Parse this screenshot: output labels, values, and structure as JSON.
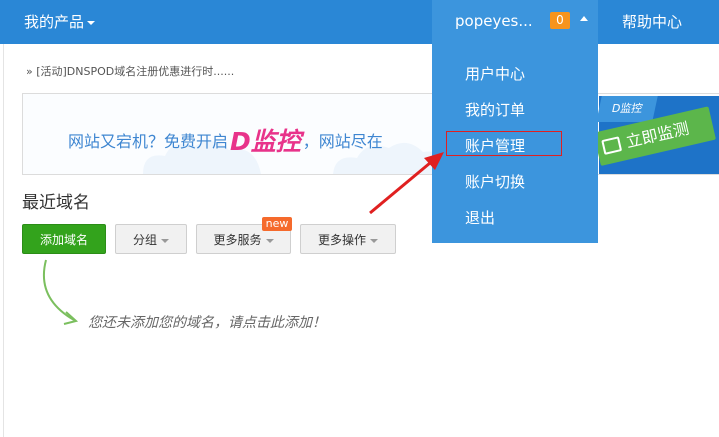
{
  "header": {
    "my_products": "我的产品",
    "username": "popeyes...",
    "message_count": "0",
    "help_center": "帮助中心"
  },
  "user_menu": {
    "items": [
      {
        "label": "用户中心"
      },
      {
        "label": "我的订单"
      },
      {
        "label": "账户管理"
      },
      {
        "label": "账户切换"
      },
      {
        "label": "退出"
      }
    ]
  },
  "announcement": "» [活动]DNSPOD域名注册优惠进行时......",
  "banner": {
    "text_before": "网站又宕机？免费开启",
    "logo_letter": "D",
    "logo_text": "监控",
    "text_after": "，网站尽在",
    "cta_tag": "D监控",
    "cta_button": "立即监测"
  },
  "domains": {
    "title": "最近域名",
    "add_domain": "添加域名",
    "group": "分组",
    "more_services": "更多服务",
    "more_services_badge": "new",
    "more_actions": "更多操作",
    "empty_hint": "您还未添加您的域名，请点击此添加！"
  },
  "colors": {
    "nav_bg": "#2a87d6",
    "menu_bg": "#3c95dd",
    "badge": "#f7941d",
    "add_button": "#33a31c",
    "annotation_red": "#e02020"
  }
}
